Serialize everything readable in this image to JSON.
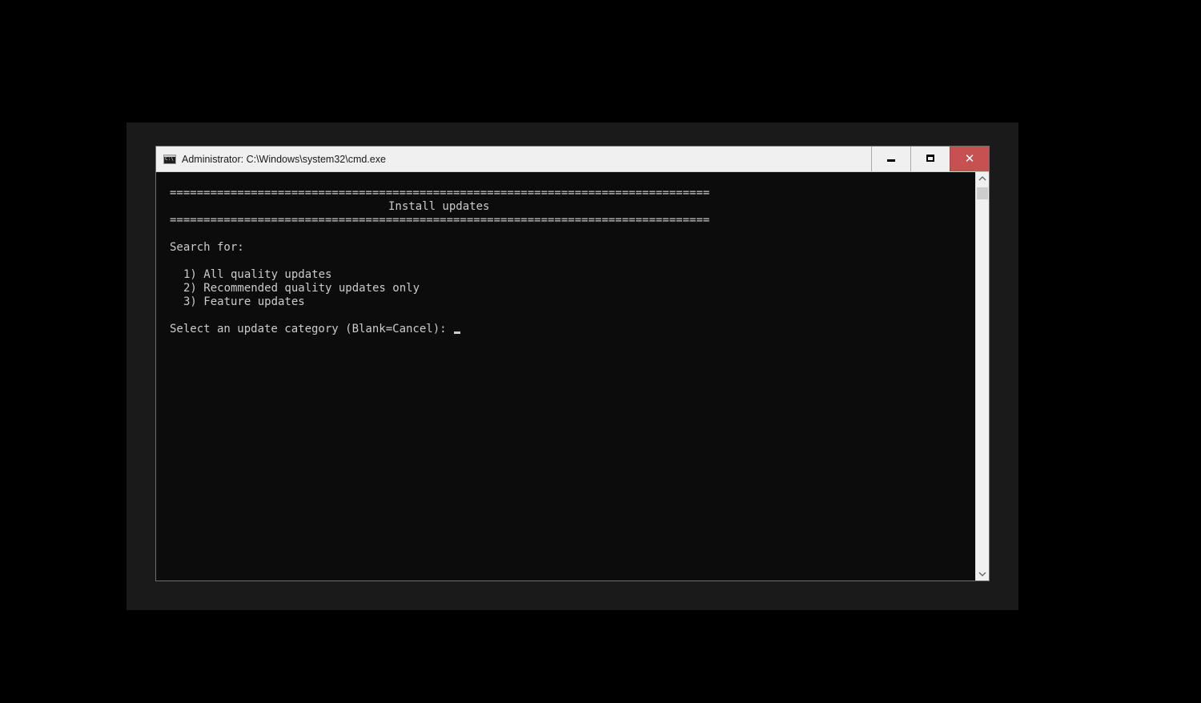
{
  "window": {
    "title": "Administrator: C:\\Windows\\system32\\cmd.exe",
    "icon": "cmd-icon",
    "controls": {
      "minimize_icon": "minimize-icon",
      "maximize_icon": "maximize-icon",
      "close_icon": "close-icon",
      "close_glyph": "✕",
      "close_color": "#c75050"
    }
  },
  "console": {
    "background": "#0c0c0c",
    "foreground": "#cccccc",
    "separator_top": "================================================================================",
    "header": "Install updates",
    "separator_bottom": "================================================================================",
    "search_label": "Search for:",
    "options": [
      "1) All quality updates",
      "2) Recommended quality updates only",
      "3) Feature updates"
    ],
    "prompt": "Select an update category (Blank=Cancel): ",
    "input_value": ""
  },
  "scrollbar": {
    "up_icon": "scroll-up-arrow-icon",
    "down_icon": "scroll-down-arrow-icon"
  }
}
